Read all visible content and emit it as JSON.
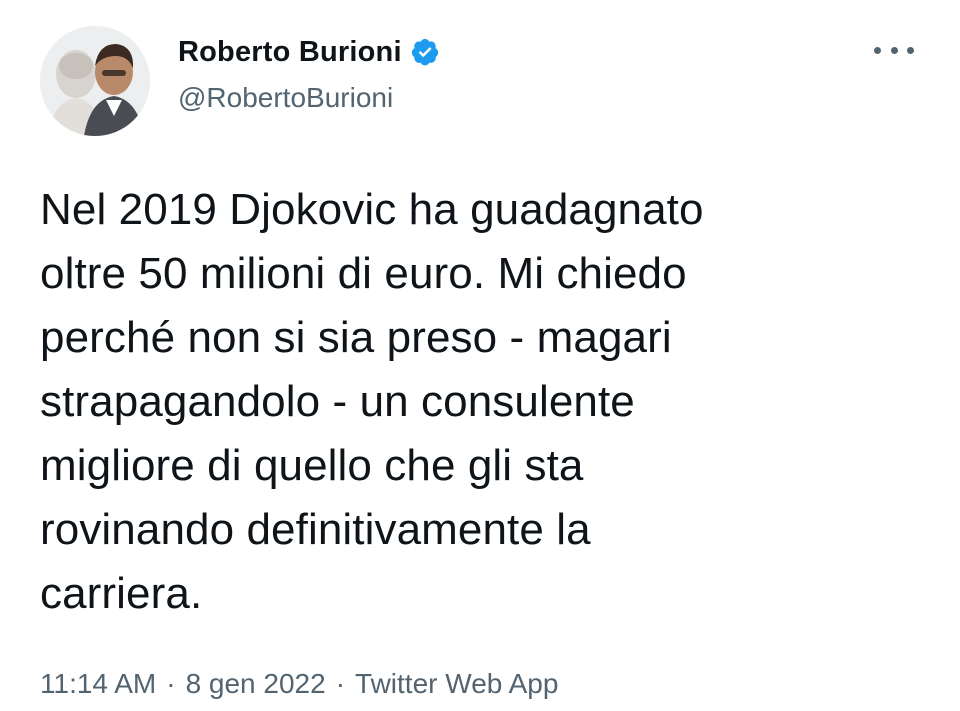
{
  "author": {
    "display_name": "Roberto Burioni",
    "handle": "@RobertoBurioni",
    "verified_icon": "verified-badge-icon",
    "avatar_icon": "avatar"
  },
  "tweet": {
    "text": "Nel 2019 Djokovic ha guadagnato\noltre 50 milioni di euro. Mi chiedo\nperché non si sia preso - magari\nstrapagandolo - un consulente\nmigliore di quello che gli sta\nrovinando definitivamente la\ncarriera."
  },
  "meta": {
    "time": "11:14 AM",
    "separator": "·",
    "date": "8 gen 2022",
    "source": "Twitter Web App"
  },
  "actions": {
    "more_icon": "more-options-icon"
  },
  "colors": {
    "text_primary": "#0f1419",
    "text_secondary": "#536471",
    "verified_blue": "#1d9bf0",
    "background": "#ffffff"
  }
}
